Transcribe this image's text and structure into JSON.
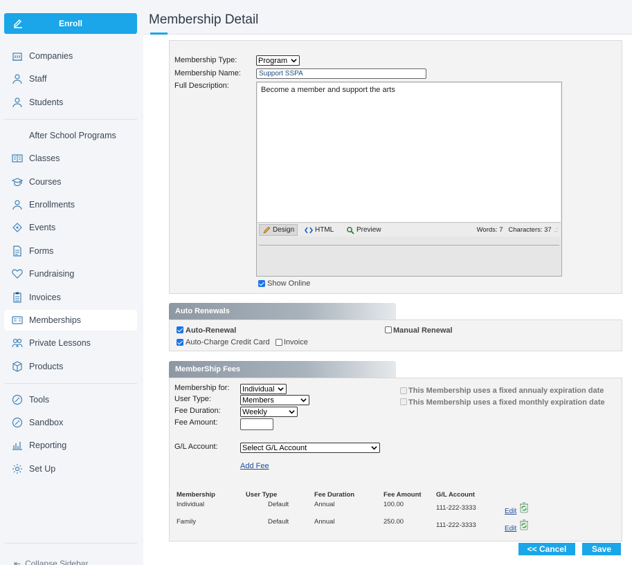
{
  "sidebar": {
    "enroll_label": "Enroll",
    "items": [
      {
        "label": "Companies",
        "icon": "companies-icon"
      },
      {
        "label": "Staff",
        "icon": "staff-icon"
      },
      {
        "label": "Students",
        "icon": "students-icon"
      },
      {
        "label": "After School Programs",
        "icon": ""
      },
      {
        "label": "Classes",
        "icon": "classes-icon"
      },
      {
        "label": "Courses",
        "icon": "courses-icon"
      },
      {
        "label": "Enrollments",
        "icon": "enrollments-icon"
      },
      {
        "label": "Events",
        "icon": "events-icon"
      },
      {
        "label": "Forms",
        "icon": "forms-icon"
      },
      {
        "label": "Fundraising",
        "icon": "fundraising-icon"
      },
      {
        "label": "Invoices",
        "icon": "invoices-icon"
      },
      {
        "label": "Memberships",
        "icon": "memberships-icon",
        "active": true
      },
      {
        "label": "Private Lessons",
        "icon": "private-lessons-icon"
      },
      {
        "label": "Products",
        "icon": "products-icon"
      },
      {
        "label": "Tools",
        "icon": "tools-icon"
      },
      {
        "label": "Sandbox",
        "icon": "sandbox-icon"
      },
      {
        "label": "Reporting",
        "icon": "reporting-icon"
      },
      {
        "label": "Set Up",
        "icon": "setup-icon"
      }
    ],
    "collapse_label": "Collapse Sidebar"
  },
  "header": {
    "title": "Membership Detail"
  },
  "details": {
    "membership_type_label": "Membership Type:",
    "membership_type_value": "Program",
    "membership_name_label": "Membership Name:",
    "membership_name_value": "Support SSPA",
    "full_description_label": "Full Description:",
    "description_text": "Become a member and support the arts",
    "editor_tabs": [
      "Design",
      "HTML",
      "Preview"
    ],
    "words_label": "Words: 7",
    "characters_label": "Characters: 37",
    "show_online_label": "Show Online",
    "show_online_checked": true
  },
  "auto_renewals": {
    "title": "Auto Renewals",
    "auto_renewal_label": "Auto-Renewal",
    "auto_renewal_checked": true,
    "manual_renewal_label": "Manual Renewal",
    "manual_renewal_checked": false,
    "auto_charge_label": "Auto-Charge Credit Card",
    "auto_charge_checked": true,
    "invoice_label": "Invoice",
    "invoice_checked": false
  },
  "fees": {
    "title": "MemberShip Fees",
    "membership_for_label": "Membership for:",
    "membership_for_value": "Individual",
    "user_type_label": "User Type:",
    "user_type_value": "Members",
    "fee_duration_label": "Fee Duration:",
    "fee_duration_value": "Weekly",
    "fee_amount_label": "Fee Amount:",
    "fee_amount_value": "",
    "gl_account_label": "G/L Account:",
    "gl_account_value": "Select G/L Account",
    "fixed_annual_label": "This Membership uses a fixed annualy expiration date",
    "fixed_monthly_label": "This Membership uses a fixed monthly expiration date",
    "add_fee_label": "Add Fee",
    "table_headers": [
      "Membership",
      "User Type",
      "Fee Duration",
      "Fee Amount",
      "G/L Account"
    ],
    "rows": [
      {
        "membership": "Individual",
        "user_type": "Default",
        "duration": "Annual",
        "amount": "100.00",
        "gl": "111-222-3333",
        "edit": "Edit"
      },
      {
        "membership": "Family",
        "user_type": "Default",
        "duration": "Annual",
        "amount": "250.00",
        "gl": "111-222-3333",
        "edit": "Edit"
      }
    ]
  },
  "actions": {
    "cancel_label": "<< Cancel",
    "save_label": "Save"
  },
  "colors": {
    "accent": "#1aa6e8",
    "sidebar_bg": "#f3f5f8"
  }
}
